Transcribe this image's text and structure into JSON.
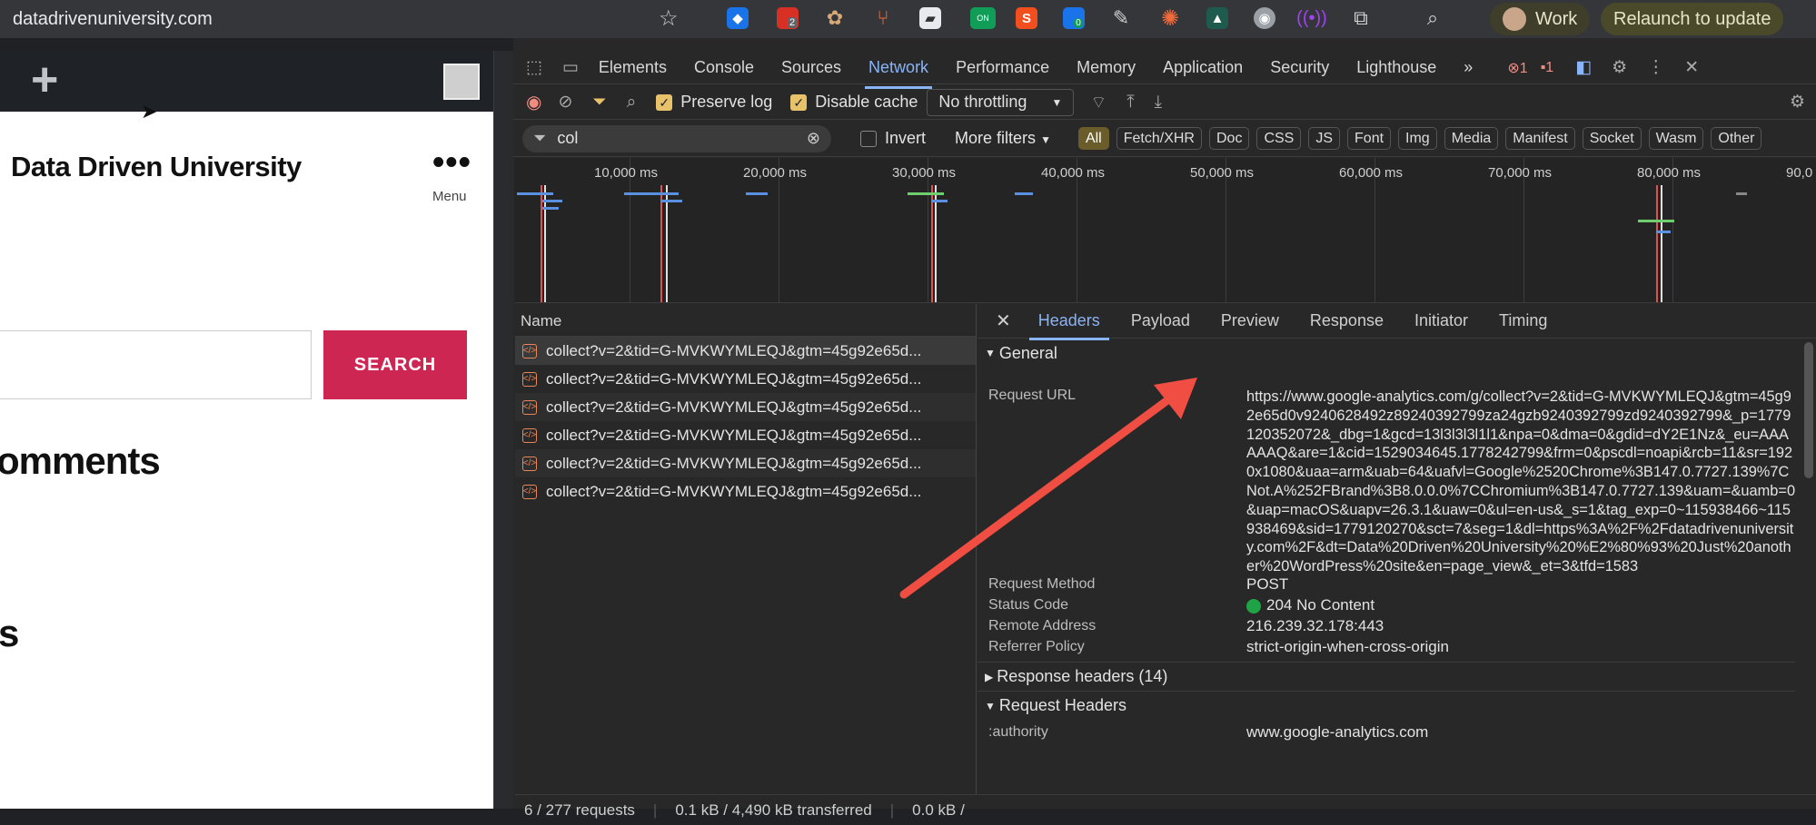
{
  "browser": {
    "url": "datadrivenuniversity.com",
    "profile_label": "Work",
    "relaunch_label": "Relaunch to update",
    "ext_badge_2": "2",
    "ext_badge_on": "ON",
    "ext_badge_0": "0"
  },
  "page": {
    "site_title": "Data Driven University",
    "menu_label": "Menu",
    "search_button": "SEARCH",
    "comments_heading": "omments",
    "fragment_heading": "s"
  },
  "devtools": {
    "tabs": [
      "Elements",
      "Console",
      "Sources",
      "Network",
      "Performance",
      "Memory",
      "Application",
      "Security",
      "Lighthouse"
    ],
    "more_tabs": "»",
    "errors_count": "1",
    "warnings_count": "1",
    "toolbar": {
      "preserve_log": "Preserve log",
      "disable_cache": "Disable cache",
      "throttling": "No throttling"
    },
    "filter": {
      "value": "col",
      "invert": "Invert",
      "more_filters": "More filters",
      "chips": [
        "All",
        "Fetch/XHR",
        "Doc",
        "CSS",
        "JS",
        "Font",
        "Img",
        "Media",
        "Manifest",
        "Socket",
        "Wasm",
        "Other"
      ]
    },
    "overview_ticks": [
      "10,000 ms",
      "20,000 ms",
      "30,000 ms",
      "40,000 ms",
      "50,000 ms",
      "60,000 ms",
      "70,000 ms",
      "80,000 ms",
      "90,0"
    ],
    "name_header": "Name",
    "requests": [
      "collect?v=2&tid=G-MVKWYMLEQJ&gtm=45g92e65d...",
      "collect?v=2&tid=G-MVKWYMLEQJ&gtm=45g92e65d...",
      "collect?v=2&tid=G-MVKWYMLEQJ&gtm=45g92e65d...",
      "collect?v=2&tid=G-MVKWYMLEQJ&gtm=45g92e65d...",
      "collect?v=2&tid=G-MVKWYMLEQJ&gtm=45g92e65d...",
      "collect?v=2&tid=G-MVKWYMLEQJ&gtm=45g92e65d..."
    ],
    "detail_tabs": [
      "Headers",
      "Payload",
      "Preview",
      "Response",
      "Initiator",
      "Timing"
    ],
    "general": {
      "title": "General",
      "request_url_label": "Request URL",
      "request_url": "https://www.google-analytics.com/g/collect?v=2&tid=G-MVKWYMLEQJ&gtm=45g92e65d0v9240628492z89240392799za24gzb9240392799zd9240392799&_p=1779120352072&_dbg=1&gcd=13l3l3l3l1l1&npa=0&dma=0&gdid=dY2E1Nz&_eu=AAAAAAQ&are=1&cid=1529034645.1778242799&frm=0&pscdl=noapi&rcb=11&sr=1920x1080&uaa=arm&uab=64&uafvl=Google%2520Chrome%3B147.0.7727.139%7CNot.A%252FBrand%3B8.0.0.0%7CChromium%3B147.0.7727.139&uam=&uamb=0&uap=macOS&uapv=26.3.1&uaw=0&ul=en-us&_s=1&tag_exp=0~115938466~115938469&sid=1779120270&sct=7&seg=1&dl=https%3A%2F%2Fdatadrivenuniversity.com%2F&dt=Data%20Driven%20University%20%E2%80%93%20Just%20another%20WordPress%20site&en=page_view&_et=3&tfd=1583",
      "request_method_label": "Request Method",
      "request_method": "POST",
      "status_code_label": "Status Code",
      "status_code": "204 No Content",
      "remote_address_label": "Remote Address",
      "remote_address": "216.239.32.178:443",
      "referrer_policy_label": "Referrer Policy",
      "referrer_policy": "strict-origin-when-cross-origin"
    },
    "response_headers": "Response headers (14)",
    "request_headers": "Request Headers",
    "authority_label": ":authority",
    "authority_value": "www.google-analytics.com",
    "status_bar": {
      "requests": "6 / 277 requests",
      "transferred": "0.1 kB / 4,490 kB transferred",
      "resources": "0.0 kB /"
    },
    "colors": {
      "accent": "#8ab4f8",
      "status_ok": "#1ea446",
      "arrow": "#f04e43"
    }
  }
}
